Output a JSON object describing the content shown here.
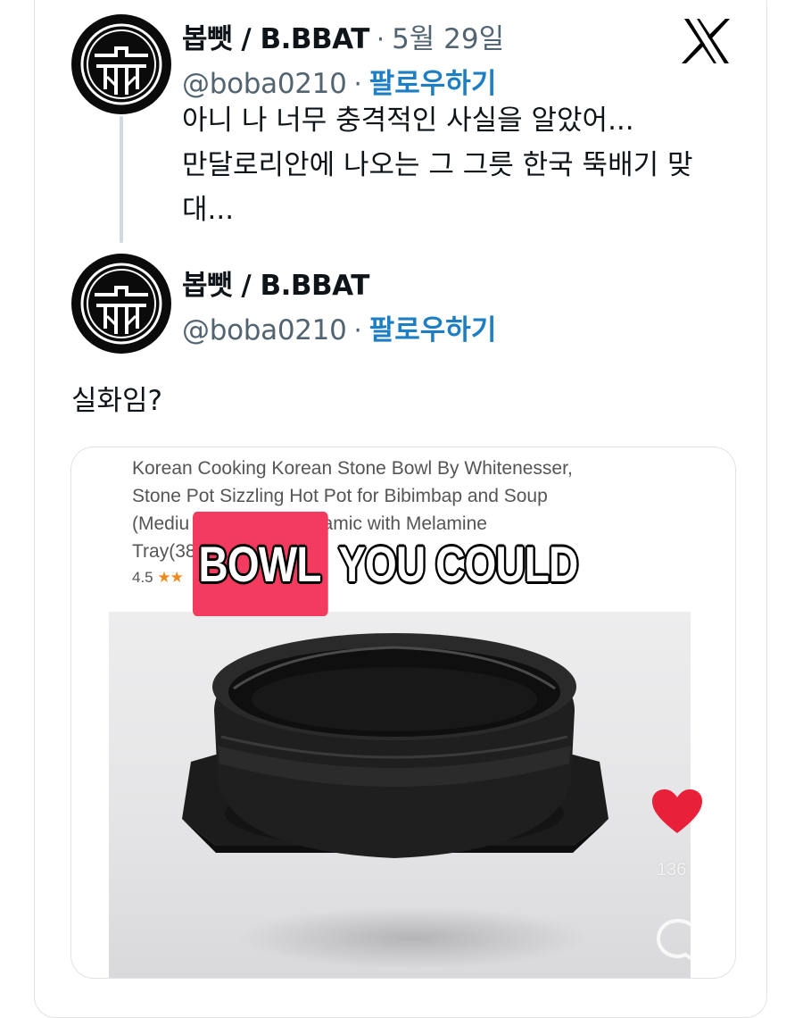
{
  "tweets": [
    {
      "display_name": "봅뺏 / B.BBAT",
      "handle": "@boba0210",
      "separator": "·",
      "date": "5월 29일",
      "follow_label": "팔로우하기",
      "text_lines": [
        "아니 나 너무 충격적인 사실을 알았어...",
        "만달로리안에 나오는 그 그릇 한국 뚝배기 맞",
        "대..."
      ]
    },
    {
      "display_name": "봅뺏 / B.BBAT",
      "handle": "@boba0210",
      "separator": "·",
      "follow_label": "팔로우하기",
      "text": "실화임?"
    }
  ],
  "platform": {
    "logo_icon": "x-logo-icon"
  },
  "media": {
    "product_title_lines": [
      "Korean Cooking Korean Stone Bowl By Whitenesser,",
      "Stone Pot Sizzling Hot Pot for Bibimbap and Soup",
      "(Mediu          mium Ceramic with Melamine",
      "Tray(38"
    ],
    "rating": "4.5",
    "rating_stars": "★★",
    "caption_highlight": "BOWL",
    "caption_rest": "YOU COULD",
    "like_count": "136",
    "colors": {
      "caption_highlight": "#f23b5f",
      "heart": "#e8203a",
      "follow": "#1d7ec3"
    }
  }
}
